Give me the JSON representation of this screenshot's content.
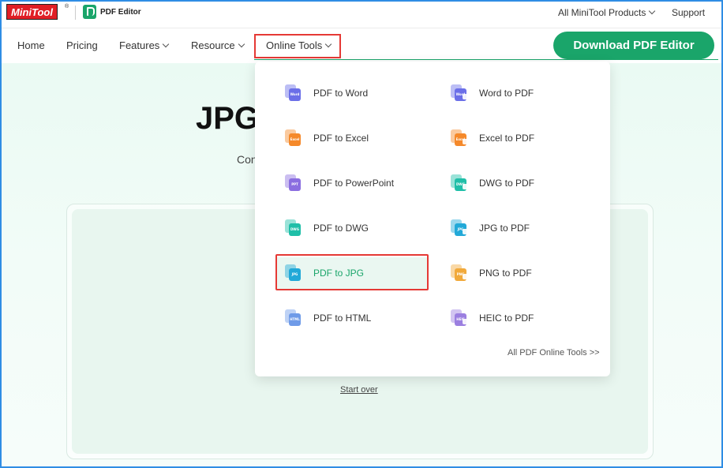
{
  "brand": {
    "minitool": "MiniTool",
    "reg": "®",
    "pdf_editor": "PDF Editor"
  },
  "topbar": {
    "all_products": "All MiniTool Products",
    "support": "Support"
  },
  "nav": {
    "home": "Home",
    "pricing": "Pricing",
    "features": "Features",
    "resource": "Resource",
    "online_tools": "Online Tools",
    "download": "Download PDF Editor"
  },
  "hero": {
    "title_visible": "JPG",
    "subtitle_visible": "Con",
    "start_over": "Start over"
  },
  "dropdown": {
    "left_column": [
      {
        "label": "PDF to Word",
        "icon": "word-file-icon",
        "badge": "Word",
        "color": "#6b6fe8"
      },
      {
        "label": "PDF to Excel",
        "icon": "excel-file-icon",
        "badge": "Excel",
        "color": "#f5892a"
      },
      {
        "label": "PDF to PowerPoint",
        "icon": "ppt-file-icon",
        "badge": "PPT",
        "color": "#8b6ee0"
      },
      {
        "label": "PDF to DWG",
        "icon": "dwg-file-icon",
        "badge": "DWG",
        "color": "#1fbfa8"
      },
      {
        "label": "PDF to JPG",
        "icon": "jpg-file-icon",
        "badge": "JPG",
        "color": "#22a9d8",
        "active": true
      },
      {
        "label": "PDF to HTML",
        "icon": "html-file-icon",
        "badge": "HTML",
        "color": "#6f9be8"
      }
    ],
    "right_column": [
      {
        "label": "Word to PDF",
        "icon": "word-to-pdf-icon",
        "badge": "Word",
        "color": "#6b6fe8"
      },
      {
        "label": "Excel to PDF",
        "icon": "excel-to-pdf-icon",
        "badge": "Excel",
        "color": "#f5892a"
      },
      {
        "label": "DWG to PDF",
        "icon": "dwg-to-pdf-icon",
        "badge": "DWG",
        "color": "#1fbfa8"
      },
      {
        "label": "JPG to PDF",
        "icon": "jpg-to-pdf-icon",
        "badge": "JPG",
        "color": "#22a9d8"
      },
      {
        "label": "PNG to PDF",
        "icon": "png-to-pdf-icon",
        "badge": "PNG",
        "color": "#f1a93a"
      },
      {
        "label": "HEIC to PDF",
        "icon": "heic-to-pdf-icon",
        "badge": "HEIC",
        "color": "#9b7fe0"
      }
    ],
    "all_tools": "All PDF Online Tools >>"
  },
  "colors": {
    "brand_green": "#1aa56a",
    "highlight_red": "#e53935",
    "frame_blue": "#2f8de4"
  }
}
